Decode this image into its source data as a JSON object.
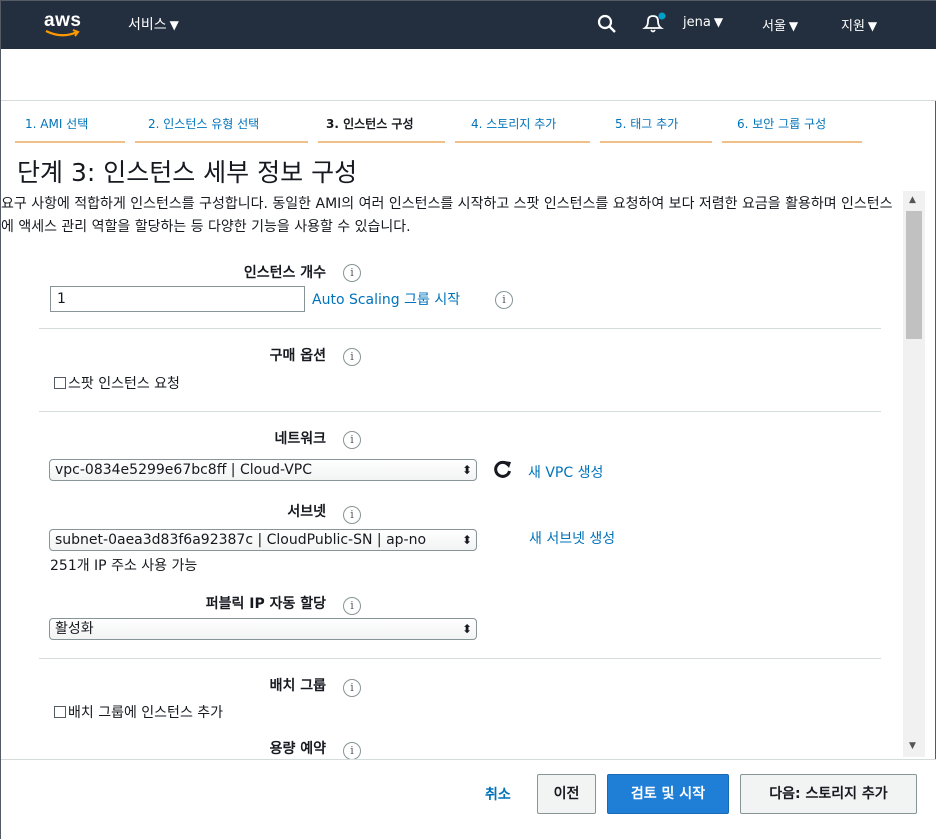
{
  "nav": {
    "logo": "aws",
    "services": "서비스",
    "user": "jena",
    "region": "서울",
    "support": "지원",
    "caret": "▼",
    "bell_badge_color": "#00a1c9"
  },
  "steps": [
    {
      "label": "1. AMI 선택"
    },
    {
      "label": "2. 인스턴스 유형 선택"
    },
    {
      "label": "3. 인스턴스 구성"
    },
    {
      "label": "4. 스토리지 추가"
    },
    {
      "label": "5. 태그 추가"
    },
    {
      "label": "6. 보안 그룹 구성"
    }
  ],
  "active_step": 2,
  "page": {
    "title": "단계 3: 인스턴스 세부 정보 구성",
    "description": "요구 사항에 적합하게 인스턴스를 구성합니다. 동일한 AMI의 여러 인스턴스를 시작하고 스팟 인스턴스를 요청하여 보다 저렴한 요금을 활용하며 인스턴스에 액세스 관리 역할을 할당하는 등 다양한 기능을 사용할 수 있습니다."
  },
  "form": {
    "instance_count": {
      "label": "인스턴스 개수",
      "value": "1",
      "link": "Auto Scaling 그룹 시작"
    },
    "purchase": {
      "label": "구매 옵션",
      "checkbox": "스팟 인스턴스 요청"
    },
    "network": {
      "label": "네트워크",
      "value": "vpc-0834e5299e67bc8ff | Cloud-VPC",
      "link": "새 VPC 생성"
    },
    "subnet": {
      "label": "서브넷",
      "value": "subnet-0aea3d83f6a92387c | CloudPublic-SN | ap-no",
      "link": "새 서브넷 생성",
      "available": "251개 IP 주소 사용 가능"
    },
    "public_ip": {
      "label": "퍼블릭 IP 자동 할당",
      "value": "활성화"
    },
    "placement": {
      "label": "배치 그룹",
      "checkbox": "배치 그룹에 인스턴스 추가"
    },
    "capacity": {
      "label": "용량 예약"
    }
  },
  "footer": {
    "cancel": "취소",
    "prev": "이전",
    "review": "검토 및 시작",
    "next": "다음: 스토리지 추가"
  }
}
